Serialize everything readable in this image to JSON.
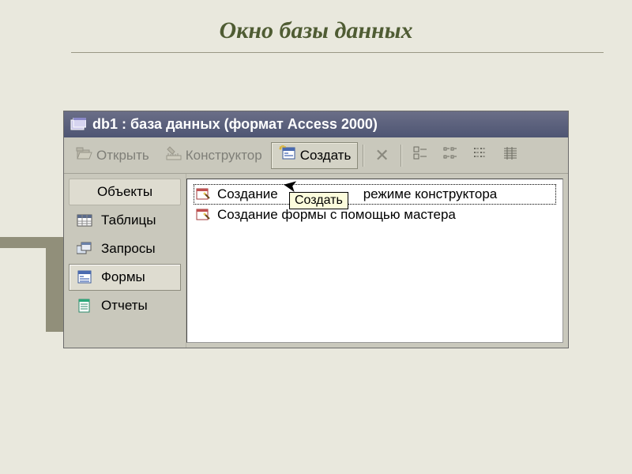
{
  "slide": {
    "title": "Окно базы данных"
  },
  "window": {
    "title": "db1 : база данных (формат Access 2000)"
  },
  "toolbar": {
    "open": "Открыть",
    "designer": "Конструктор",
    "create": "Создать"
  },
  "sidebar": {
    "header": "Объекты",
    "tables": "Таблицы",
    "queries": "Запросы",
    "forms": "Формы",
    "reports": "Отчеты"
  },
  "content": {
    "row0a": "Создание",
    "row0b": "режиме конструктора",
    "row1": "Создание формы с помощью мастера"
  },
  "tooltip": {
    "text": "Создать"
  }
}
